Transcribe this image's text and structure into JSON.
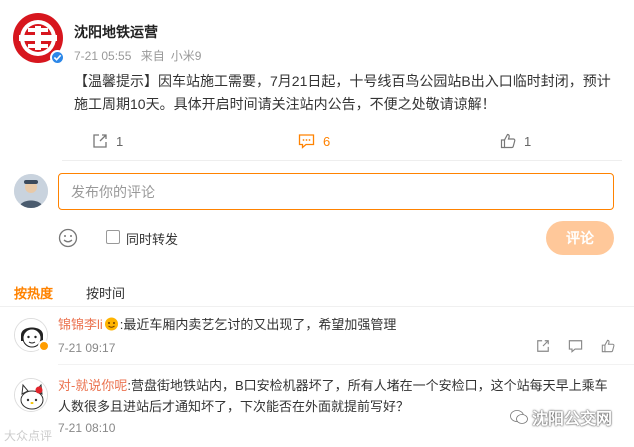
{
  "post": {
    "author": "沈阳地铁运营",
    "time": "7-21 05:55",
    "source_prefix": "来自",
    "source": "小米9",
    "text": "【温馨提示】因车站施工需要，7月21日起，十号线百鸟公园站B出入口临时封闭，预计施工周期10天。具体开启时间请关注站内公告，不便之处敬请谅解！"
  },
  "actions": {
    "repost_count": "1",
    "comment_count": "6",
    "like_count": "1"
  },
  "composer": {
    "placeholder": "发布你的评论",
    "repost_label": "同时转发",
    "submit_label": "评论"
  },
  "sort": {
    "hot": "按热度",
    "time": "按时间"
  },
  "comments": [
    {
      "name": "锦锦李li",
      "text": ":最近车厢内卖艺乞讨的又出现了，希望加强管理",
      "time": "7-21 09:17"
    },
    {
      "name": "对-就说你呢",
      "text": ":营盘街地铁站内，B口安检机器坏了，所有人堵在一个安检口，这个站每天早上乘车人数很多且进站后才通知坏了，下次能否在外面就提前写好？",
      "time": "7-21 08:10"
    }
  ],
  "watermark": {
    "right": "沈阳公交网",
    "left": "大众点评"
  },
  "colors": {
    "accent": "#ff8200",
    "name": "#eb7350",
    "logo_red": "#d7161e"
  },
  "icons": {
    "verified": "verified-check-icon",
    "repost": "repost-icon",
    "comment": "comment-bubble-icon",
    "like": "thumbs-up-icon",
    "emoji": "smiley-icon"
  }
}
